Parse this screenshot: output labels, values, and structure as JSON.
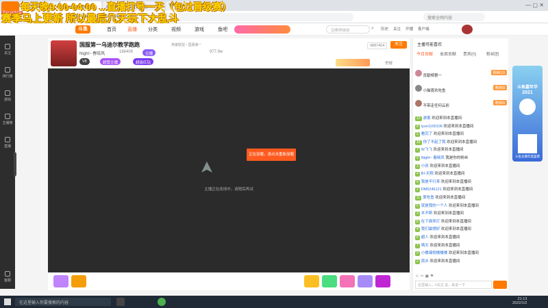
{
  "browser": {
    "tabs": [
      "WeSing",
      "斗鱼",
      "Web... 斗鱼直播",
      "斗鱼-每个人的直播平台",
      "YouTube"
    ],
    "url": "https://www.douyu.com/9999",
    "search_placeholder": "搜索全网内容"
  },
  "overlay": {
    "line1": "每天晚9:00-04:00 ...直播打号一天（包过晋级赛）",
    "line2": "赛季马上更新 所以最后几天玩下大乱斗",
    "badge": "Recording"
  },
  "site": {
    "logo": "斗鱼",
    "nav": [
      "首页",
      "直播",
      "分类",
      "视频",
      "游戏",
      "鱼吧"
    ],
    "active_nav": "直播",
    "search_placeholder": "召唤师峡谷",
    "header_icons": [
      "历史",
      "关注",
      "开播",
      "客户端"
    ]
  },
  "sidebar": [
    "关注",
    "排行榜",
    "游戏",
    "主播榜",
    "直播",
    "客服"
  ],
  "room": {
    "title": "国服第一乌迪尔教学跑跑",
    "streamer": "Night~ 春晓风",
    "host_level": "ID 9999",
    "hot": "168408",
    "tags": [
      "英雄联盟",
      "国服第一",
      "主播"
    ],
    "follow_label": "关注",
    "follow_count": "4887404",
    "report": "举报",
    "viewers": "977.9w",
    "badges": [
      "V8",
      "超管主播",
      "超级红钻"
    ]
  },
  "player": {
    "popup": "正在加载，请点击重新加载",
    "status": "主播正在连线中，请稍后再试"
  },
  "gifts": [
    "鱼翅",
    "粉丝荧光棒",
    "办卡",
    "飞机",
    "火箭",
    "超级火箭",
    "更多"
  ],
  "chat": {
    "tabs": [
      "今日贡献",
      "本周贡献",
      "贵宾(0)",
      "粉丝团"
    ],
    "rank_header": "主播可能喜欢",
    "rank_rows": [
      {
        "name": "贡献榜第一",
        "badge": "粉丝10"
      },
      {
        "name": "小猫喜欢吃鱼",
        "badge": "粉丝8"
      },
      {
        "name": "不带走任何云彩",
        "badge": "粉丝6"
      }
    ],
    "messages": [
      {
        "lv": "12",
        "user": "游客",
        "text": "欢迎来到本直播间"
      },
      {
        "lv": "8",
        "user": "iyun1100106",
        "text": "欢迎来到本直播间"
      },
      {
        "lv": "5",
        "user": "看完了",
        "text": "欢迎来到本直播间"
      },
      {
        "lv": "18",
        "user": "你了不起了我",
        "text": "欢迎来到本直播间"
      },
      {
        "lv": "7",
        "user": "W飞飞",
        "text": "欢迎来到本直播间"
      },
      {
        "lv": "9",
        "user": "Night~ 春晓风",
        "text": "我是你的粉丝"
      },
      {
        "lv": "3",
        "user": "小孩",
        "text": "欢迎来到本直播间"
      },
      {
        "lv": "4",
        "user": "BI-天翔",
        "text": "欢迎来到本直播间"
      },
      {
        "lv": "6",
        "user": "我是不行来",
        "text": "欢迎来到本直播间"
      },
      {
        "lv": "2",
        "user": "DM5246121",
        "text": "欢迎来到本直播间"
      },
      {
        "lv": "11",
        "user": "爱吃鱼",
        "text": "欢迎来到本直播间"
      },
      {
        "lv": "5",
        "user": "就是我的一个人",
        "text": "欢迎来到本直播间"
      },
      {
        "lv": "3",
        "user": "木不斯",
        "text": "欢迎来到本直播间"
      },
      {
        "lv": "8",
        "user": "在下面来打",
        "text": "欢迎来到本直播间"
      },
      {
        "lv": "4",
        "user": "我们最想好",
        "text": "欢迎来到本直播间"
      },
      {
        "lv": "6",
        "user": "超人",
        "text": "欢迎来到本直播间"
      },
      {
        "lv": "7",
        "user": "晴天",
        "text": "欢迎来到本直播间"
      },
      {
        "lv": "9",
        "user": "小楼凝视楼楼楼",
        "text": "欢迎来到本直播间"
      },
      {
        "lv": "2",
        "user": "雨水",
        "text": "欢迎来到本直播间"
      }
    ],
    "input_placeholder": "这里输入，#关注 说，来说一下"
  },
  "ad": {
    "title": "斗鱼嘉年华",
    "year": "2021",
    "sub": "斗鱼主播年度盛典"
  },
  "taskbar": {
    "search_placeholder": "在这里输入你要搜索的内容",
    "time": "21:13",
    "date": "2022/1/2"
  }
}
